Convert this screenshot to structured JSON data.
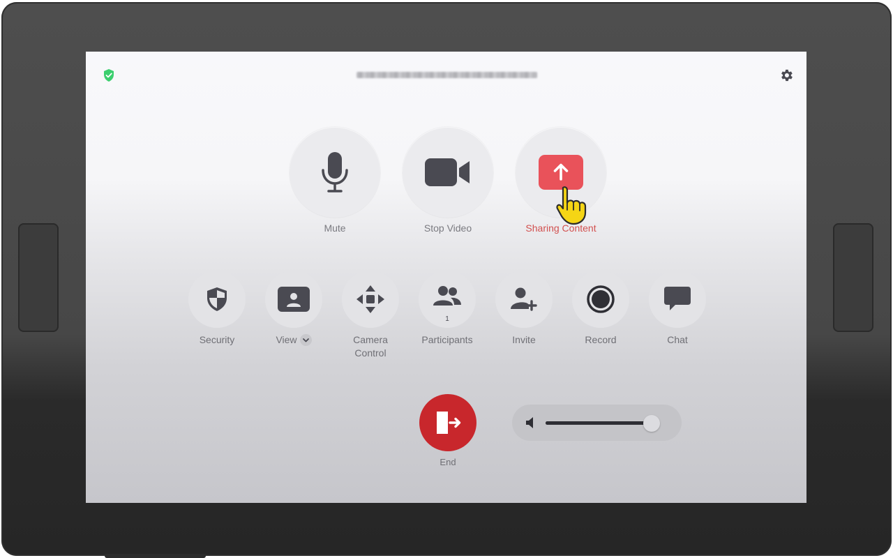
{
  "colors": {
    "accent_red": "#d2504f",
    "end_red": "#c8272c",
    "share_red": "#e9525a",
    "secure_green": "#3ccf6e",
    "icon_dark": "#4a4a52"
  },
  "header": {
    "secure_icon": "shield-check-icon",
    "settings_icon": "gear-icon"
  },
  "primary_controls": [
    {
      "label": "Mute",
      "icon": "microphone-icon"
    },
    {
      "label": "Stop Video",
      "icon": "video-camera-icon"
    },
    {
      "label": "Sharing Content",
      "icon": "share-upload-icon"
    }
  ],
  "secondary_controls": [
    {
      "label": "Security",
      "icon": "shield-icon"
    },
    {
      "label": "View",
      "icon": "speaker-view-icon"
    },
    {
      "label": "Camera\nControl",
      "icon": "move-arrows-icon"
    },
    {
      "label": "Participants",
      "icon": "participants-icon",
      "count": "1"
    },
    {
      "label": "Invite",
      "icon": "add-user-icon"
    },
    {
      "label": "Record",
      "icon": "record-icon"
    },
    {
      "label": "Chat",
      "icon": "chat-bubble-icon"
    }
  ],
  "end": {
    "label": "End",
    "icon": "exit-door-icon"
  },
  "volume": {
    "level": 0.95,
    "icon": "speaker-icon"
  }
}
